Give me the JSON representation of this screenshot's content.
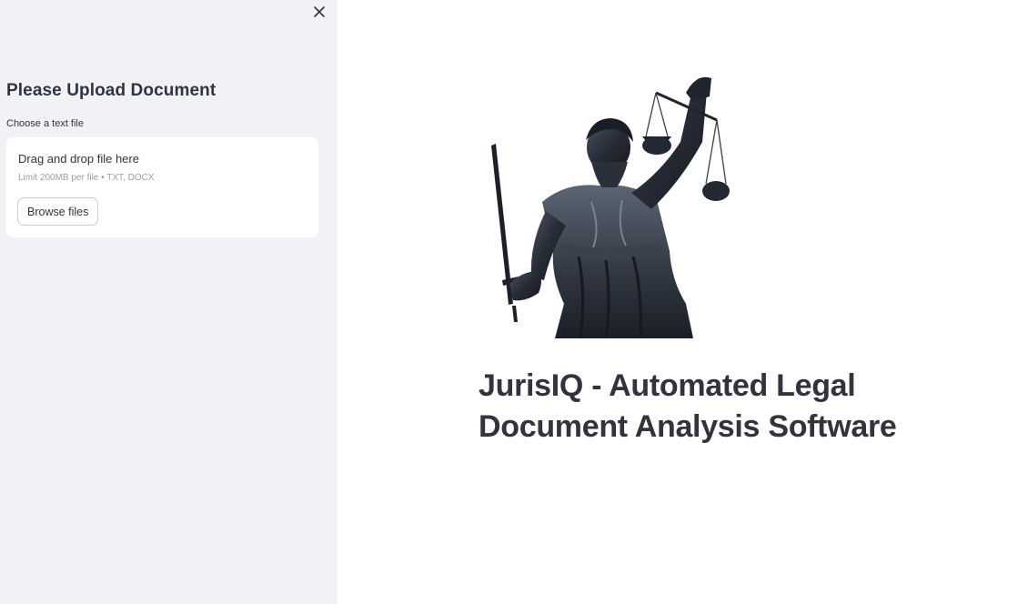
{
  "sidebar": {
    "close_icon": "close-icon",
    "heading": "Please Upload Document",
    "uploader": {
      "label": "Choose a text file",
      "drop_text": "Drag and drop file here",
      "limit_text": "Limit 200MB per file • TXT, DOCX",
      "browse_label": "Browse files"
    }
  },
  "main": {
    "hero_image": "lady-justice-statue",
    "title_line1": "JurisIQ - Automated Legal",
    "title_line2": "Document Analysis Software"
  },
  "colors": {
    "sidebar_bg": "#f0f2f6",
    "text": "#31333f",
    "muted": "#9a9ca3"
  }
}
